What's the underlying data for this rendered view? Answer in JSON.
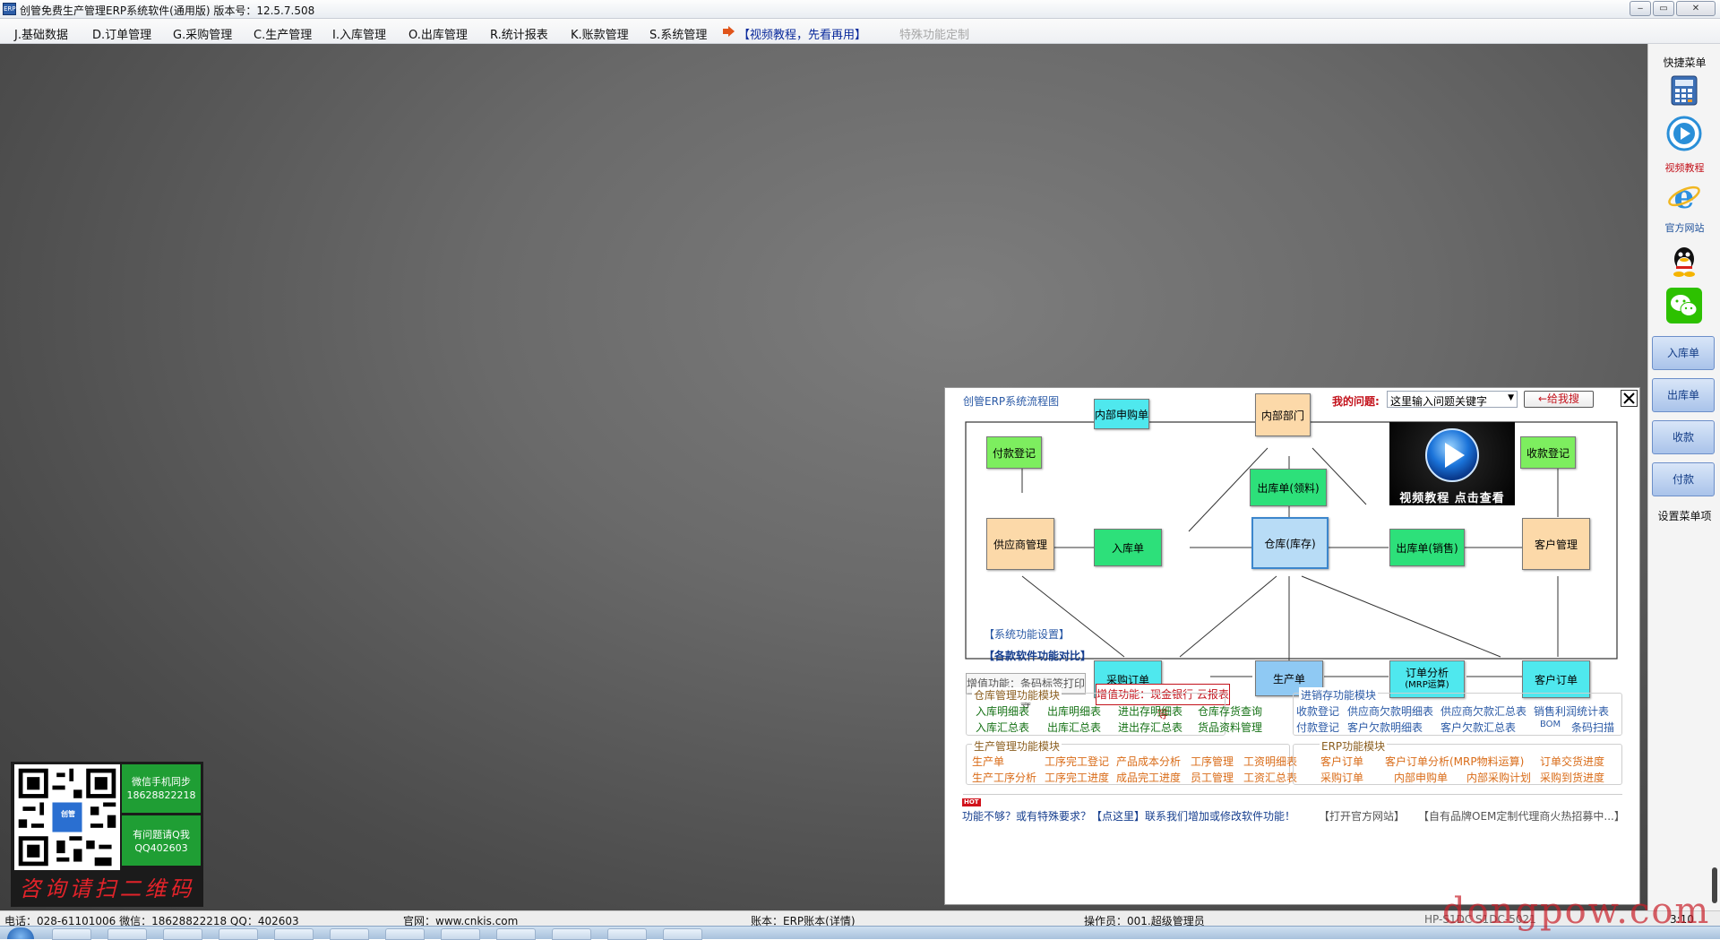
{
  "window": {
    "title": "创管免费生产管理ERP系统软件(通用版) 版本号：12.5.7.508",
    "icon": "app-logo-icon",
    "buttons": {
      "minimize": "‒",
      "restore": "▭",
      "close": "✕"
    }
  },
  "menu": [
    "J.基础数据",
    "D.订单管理",
    "G.采购管理",
    "C.生产管理",
    "I.入库管理",
    "O.出库管理",
    "R.统计报表",
    "K.账款管理",
    "S.系统管理"
  ],
  "menu_video": "【视频教程，先看再用】",
  "menu_special": "特殊功能定制",
  "right_panel": {
    "title": "快捷菜单",
    "icon_calculator": "calculator-icon",
    "video_label": "视频教程",
    "ie_label": "官方网站",
    "qq_icon": "qq-icon",
    "wechat_icon": "wechat-icon",
    "buttons": [
      "入库单",
      "出库单",
      "收款",
      "付款"
    ],
    "settings": "设置菜单项"
  },
  "flow": {
    "title": "创管ERP系统流程图",
    "question_label": "我的问题:",
    "search_placeholder": "这里输入问题关键字",
    "search_button": "←给我搜",
    "close_icon": "close-x-icon",
    "video_caption": "视频教程 点击查看",
    "nodes": {
      "internal_request": "内部申购单",
      "internal_dept": "内部部门",
      "payment": "付款登记",
      "outbound_pick": "出库单(领料)",
      "receipt": "收款登记",
      "supplier": "供应商管理",
      "inbound": "入库单",
      "warehouse": "仓库(库存)",
      "outbound_sale": "出库单(销售)",
      "customer": "客户管理",
      "purchase_order": "采购订单",
      "production_order": "生产单",
      "order_analysis_1": "订单分析",
      "order_analysis_2": "(MRP运算)",
      "customer_order": "客户订单"
    },
    "sys_settings": "【系统功能设置】",
    "compare": "【各款软件功能对比】",
    "addon1": "增值功能：条码标签打印等",
    "addon2": "增值功能：现金银行 云报表等",
    "warehouse_section": {
      "title": "仓库管理功能模块",
      "row1": [
        "入库明细表",
        "出库明细表",
        "进出存明细表",
        "仓库存货查询"
      ],
      "row2": [
        "入库汇总表",
        "出库汇总表",
        "进出存汇总表",
        "货品资料管理"
      ]
    },
    "jxc_section": {
      "title": "进销存功能模块",
      "row1": [
        "收款登记",
        "供应商欠款明细表",
        "供应商欠款汇总表",
        "销售利润统计表"
      ],
      "row2": [
        "付款登记",
        "客户欠款明细表",
        "客户欠款汇总表",
        "BOM",
        "条码扫描"
      ]
    },
    "production_section": {
      "title": "生产管理功能模块",
      "row1": [
        "生产单",
        "工序完工登记",
        "产品成本分析",
        "工序管理",
        "工资明细表"
      ],
      "row2": [
        "生产工序分析",
        "工序完工进度",
        "成品完工进度",
        "员工管理",
        "工资汇总表"
      ]
    },
    "erp_section": {
      "title": "ERP功能模块",
      "row1": [
        "客户订单",
        "客户订单分析(MRP物料运算)",
        "订单交货进度"
      ],
      "row2": [
        "采购订单",
        "内部申购单",
        "内部采购计划",
        "采购到货进度"
      ]
    },
    "hot_badge": "HOT",
    "footer_left": "功能不够？或有特殊要求？【点这里】联系我们增加或修改软件功能！",
    "footer_official": "【打开官方网站】",
    "footer_oem": "【自有品牌OEM定制代理商火热招募中...】"
  },
  "qr": {
    "top_text_1": "微信手机同步",
    "top_text_2": "18628822218",
    "bottom_text_1": "有问题请Q我",
    "bottom_text_2": "QQ402603",
    "logo": "创管",
    "banner": "咨询请扫二维码"
  },
  "status": {
    "phone": "电话：028-61101006 微信：18628822218 QQ：402603",
    "site": "官网：www.cnkis.com",
    "account": "账本：ERP账本(详情)",
    "operator": "操作员：001.超级管理员",
    "hp": "HP-S1DC  S1DC-5021",
    "right": "3:10"
  },
  "watermark": "dongpow.com",
  "colors": {
    "accent": "#2b5aa6",
    "red": "#c3121b",
    "green": "#167216"
  }
}
